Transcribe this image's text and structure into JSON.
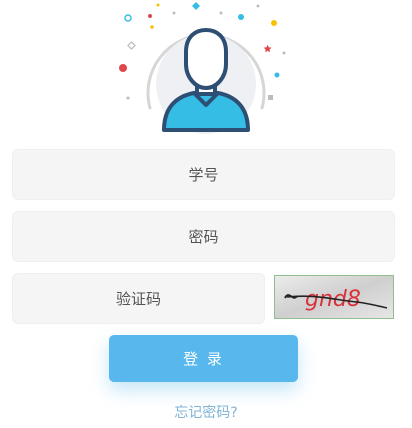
{
  "form": {
    "username_placeholder": "学号",
    "password_placeholder": "密码",
    "captcha_placeholder": "验证码",
    "captcha_text": "gnd8",
    "login_label": "登 录",
    "forgot_label": "忘记密码?"
  },
  "icons": {
    "avatar": "user-avatar-icon",
    "confetti": "confetti-decoration"
  },
  "colors": {
    "accent": "#58b7ec",
    "field_bg": "#f4f5f4",
    "link": "#7fb4d6",
    "avatar_outline": "#2d4f73",
    "avatar_shirt": "#35bde6",
    "captcha_text": "#d9313b"
  }
}
